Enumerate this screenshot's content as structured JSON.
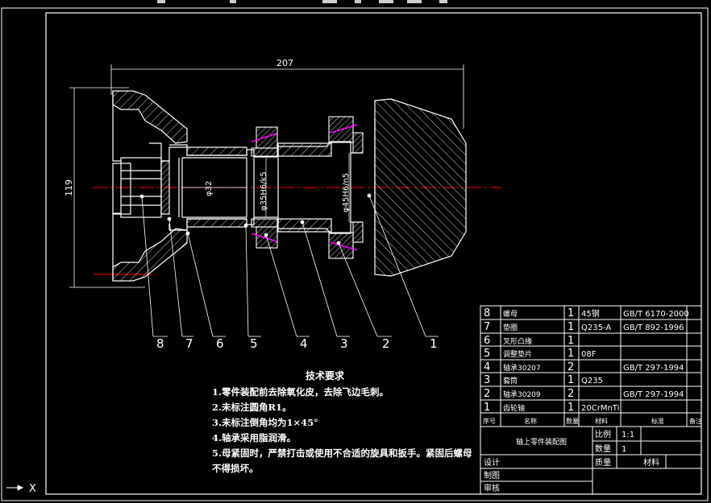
{
  "toolbar": {
    "note": ""
  },
  "drawing": {
    "dim_overall_length": "207",
    "dim_height": "119",
    "dim_bore": "φ32",
    "dim_shaft_1": "φ35H6/k5",
    "dim_shaft_2": "φ45H6/n5",
    "balloons": [
      "8",
      "7",
      "6",
      "5",
      "4",
      "3",
      "2",
      "1"
    ]
  },
  "technical_requirements": {
    "title": "技术要求",
    "items": [
      "1.零件装配前去除氧化皮，去除飞边毛刺。",
      "2.未标注圆角R1。",
      "3.未标注倒角均为1×45°",
      "4.轴承采用脂润滑。",
      "5.母紧固时，严禁打击或使用不合适的旋具和扳手。紧固后螺母",
      "不得损坏。"
    ]
  },
  "parts_list": {
    "rows": [
      {
        "no": "8",
        "name": "螺母",
        "qty": "1",
        "material": "45钢",
        "standard": "GB/T 6170-2000"
      },
      {
        "no": "7",
        "name": "垫圈",
        "qty": "1",
        "material": "Q235-A",
        "standard": "GB/T 892-1996"
      },
      {
        "no": "6",
        "name": "叉形凸缘",
        "qty": "1",
        "material": "",
        "standard": ""
      },
      {
        "no": "5",
        "name": "调整垫片",
        "qty": "1",
        "material": "08F",
        "standard": ""
      },
      {
        "no": "4",
        "name": "轴承30207",
        "qty": "2",
        "material": "",
        "standard": "GB/T 297-1994"
      },
      {
        "no": "3",
        "name": "套筒",
        "qty": "1",
        "material": "Q235",
        "standard": ""
      },
      {
        "no": "2",
        "name": "轴承30209",
        "qty": "2",
        "material": "",
        "standard": "GB/T 297-1994"
      },
      {
        "no": "1",
        "name": "齿轮轴",
        "qty": "1",
        "material": "20CrMnTi",
        "standard": ""
      }
    ],
    "header": {
      "no": "序号",
      "name": "名称",
      "qty": "数量",
      "material": "材料",
      "standard": "标准",
      "remark": "备注"
    }
  },
  "title_block": {
    "drawing_name": "轴上零件装配图",
    "scale_label": "比例",
    "scale_value": "1:1",
    "qty_label": "数量",
    "qty_value": "1",
    "mass_label": "质量",
    "material_label": "材料",
    "design_label": "设计",
    "draw_label": "制图",
    "review_label": "审核"
  },
  "ucs": {
    "x_label": "X"
  },
  "colors": {
    "background": "#000000",
    "lines": "#ffffff",
    "centerline": "#ff0000",
    "bearing": "#ff00ff"
  }
}
